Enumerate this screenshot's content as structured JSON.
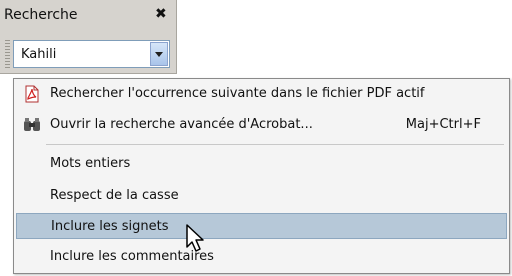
{
  "panel": {
    "title": "Recherche",
    "close_glyph": "✖",
    "search_value": "Kahili"
  },
  "menu": {
    "items": [
      {
        "label": "Rechercher l'occurrence suivante dans le fichier PDF actif",
        "icon": "pdf-icon"
      },
      {
        "label": "Ouvrir la recherche avancée d'Acrobat...",
        "shortcut": "Maj+Ctrl+F",
        "icon": "binoculars-icon"
      },
      {
        "label": "Mots entiers"
      },
      {
        "label": "Respect de la casse"
      },
      {
        "label": "Inclure les signets",
        "selected": true
      },
      {
        "label": "Inclure les commentaires"
      }
    ]
  },
  "colors": {
    "panel_bg": "#d6d3ce",
    "menu_bg": "#f4f4f4",
    "highlight": "#b6c8d8"
  }
}
